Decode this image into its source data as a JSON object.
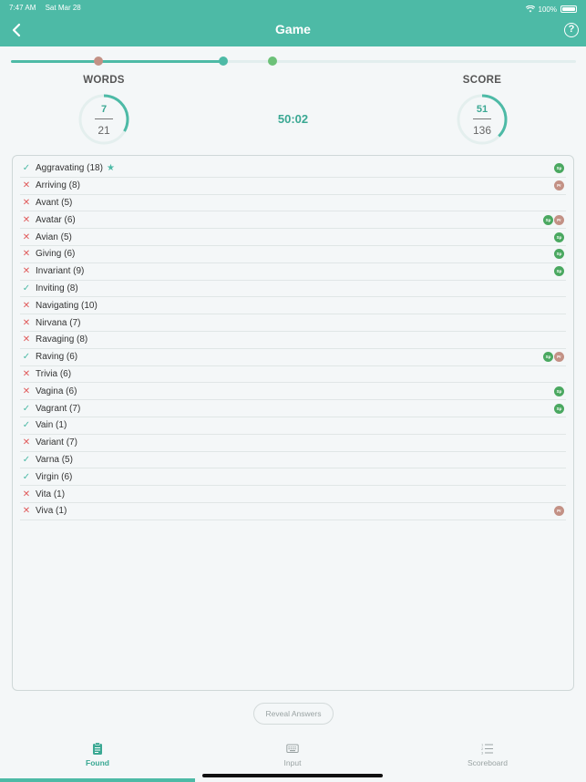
{
  "status": {
    "time": "7:47 AM",
    "date": "Sat Mar 28",
    "battery": "100%"
  },
  "header": {
    "title": "Game",
    "back_icon": "chevron-left-icon",
    "help_icon": "question-circle-icon"
  },
  "progress": {
    "fill_fraction": 0.375,
    "markers": [
      {
        "name": "pr-marker",
        "fraction": 0.155,
        "color": "#c39185"
      },
      {
        "name": "current-marker",
        "fraction": 0.375,
        "color": "#4dbaa6"
      },
      {
        "name": "sp-marker",
        "fraction": 0.463,
        "color": "#6cc178"
      }
    ]
  },
  "stats": {
    "words": {
      "label": "WORDS",
      "value": "7",
      "total": "21",
      "fraction": 0.333
    },
    "score": {
      "label": "SCORE",
      "value": "51",
      "total": "136",
      "fraction": 0.375
    },
    "timer": "50:02"
  },
  "words": [
    {
      "text": "Aggravating (18)",
      "ok": true,
      "star": true,
      "badges": [
        "Sp"
      ]
    },
    {
      "text": "Arriving (8)",
      "ok": false,
      "star": false,
      "badges": [
        "Pr"
      ]
    },
    {
      "text": "Avant (5)",
      "ok": false,
      "star": false,
      "badges": []
    },
    {
      "text": "Avatar (6)",
      "ok": false,
      "star": false,
      "badges": [
        "Sp",
        "Pr"
      ]
    },
    {
      "text": "Avian (5)",
      "ok": false,
      "star": false,
      "badges": [
        "Sp"
      ]
    },
    {
      "text": "Giving (6)",
      "ok": false,
      "star": false,
      "badges": [
        "Sp"
      ]
    },
    {
      "text": "Invariant (9)",
      "ok": false,
      "star": false,
      "badges": [
        "Sp"
      ]
    },
    {
      "text": "Inviting (8)",
      "ok": true,
      "star": false,
      "badges": []
    },
    {
      "text": "Navigating (10)",
      "ok": false,
      "star": false,
      "badges": []
    },
    {
      "text": "Nirvana (7)",
      "ok": false,
      "star": false,
      "badges": []
    },
    {
      "text": "Ravaging (8)",
      "ok": false,
      "star": false,
      "badges": []
    },
    {
      "text": "Raving (6)",
      "ok": true,
      "star": false,
      "badges": [
        "Sp",
        "Pr"
      ]
    },
    {
      "text": "Trivia (6)",
      "ok": false,
      "star": false,
      "badges": []
    },
    {
      "text": "Vagina (6)",
      "ok": false,
      "star": false,
      "badges": [
        "Sp"
      ]
    },
    {
      "text": "Vagrant (7)",
      "ok": true,
      "star": false,
      "badges": [
        "Sp"
      ]
    },
    {
      "text": "Vain (1)",
      "ok": true,
      "star": false,
      "badges": []
    },
    {
      "text": "Variant (7)",
      "ok": false,
      "star": false,
      "badges": []
    },
    {
      "text": "Varna (5)",
      "ok": true,
      "star": false,
      "badges": []
    },
    {
      "text": "Virgin (6)",
      "ok": true,
      "star": false,
      "badges": []
    },
    {
      "text": "Vita (1)",
      "ok": false,
      "star": false,
      "badges": []
    },
    {
      "text": "Viva (1)",
      "ok": false,
      "star": false,
      "badges": [
        "Pr"
      ]
    }
  ],
  "reveal_button": "Reveal Answers",
  "tabs": [
    {
      "label": "Found",
      "icon": "clipboard-icon",
      "active": true
    },
    {
      "label": "Input",
      "icon": "keyboard-icon",
      "active": false
    },
    {
      "label": "Scoreboard",
      "icon": "list-icon",
      "active": false
    }
  ],
  "colors": {
    "accent": "#4dbaa6",
    "error": "#e05a5a",
    "sp": "#4aa860",
    "pr": "#c39185"
  }
}
